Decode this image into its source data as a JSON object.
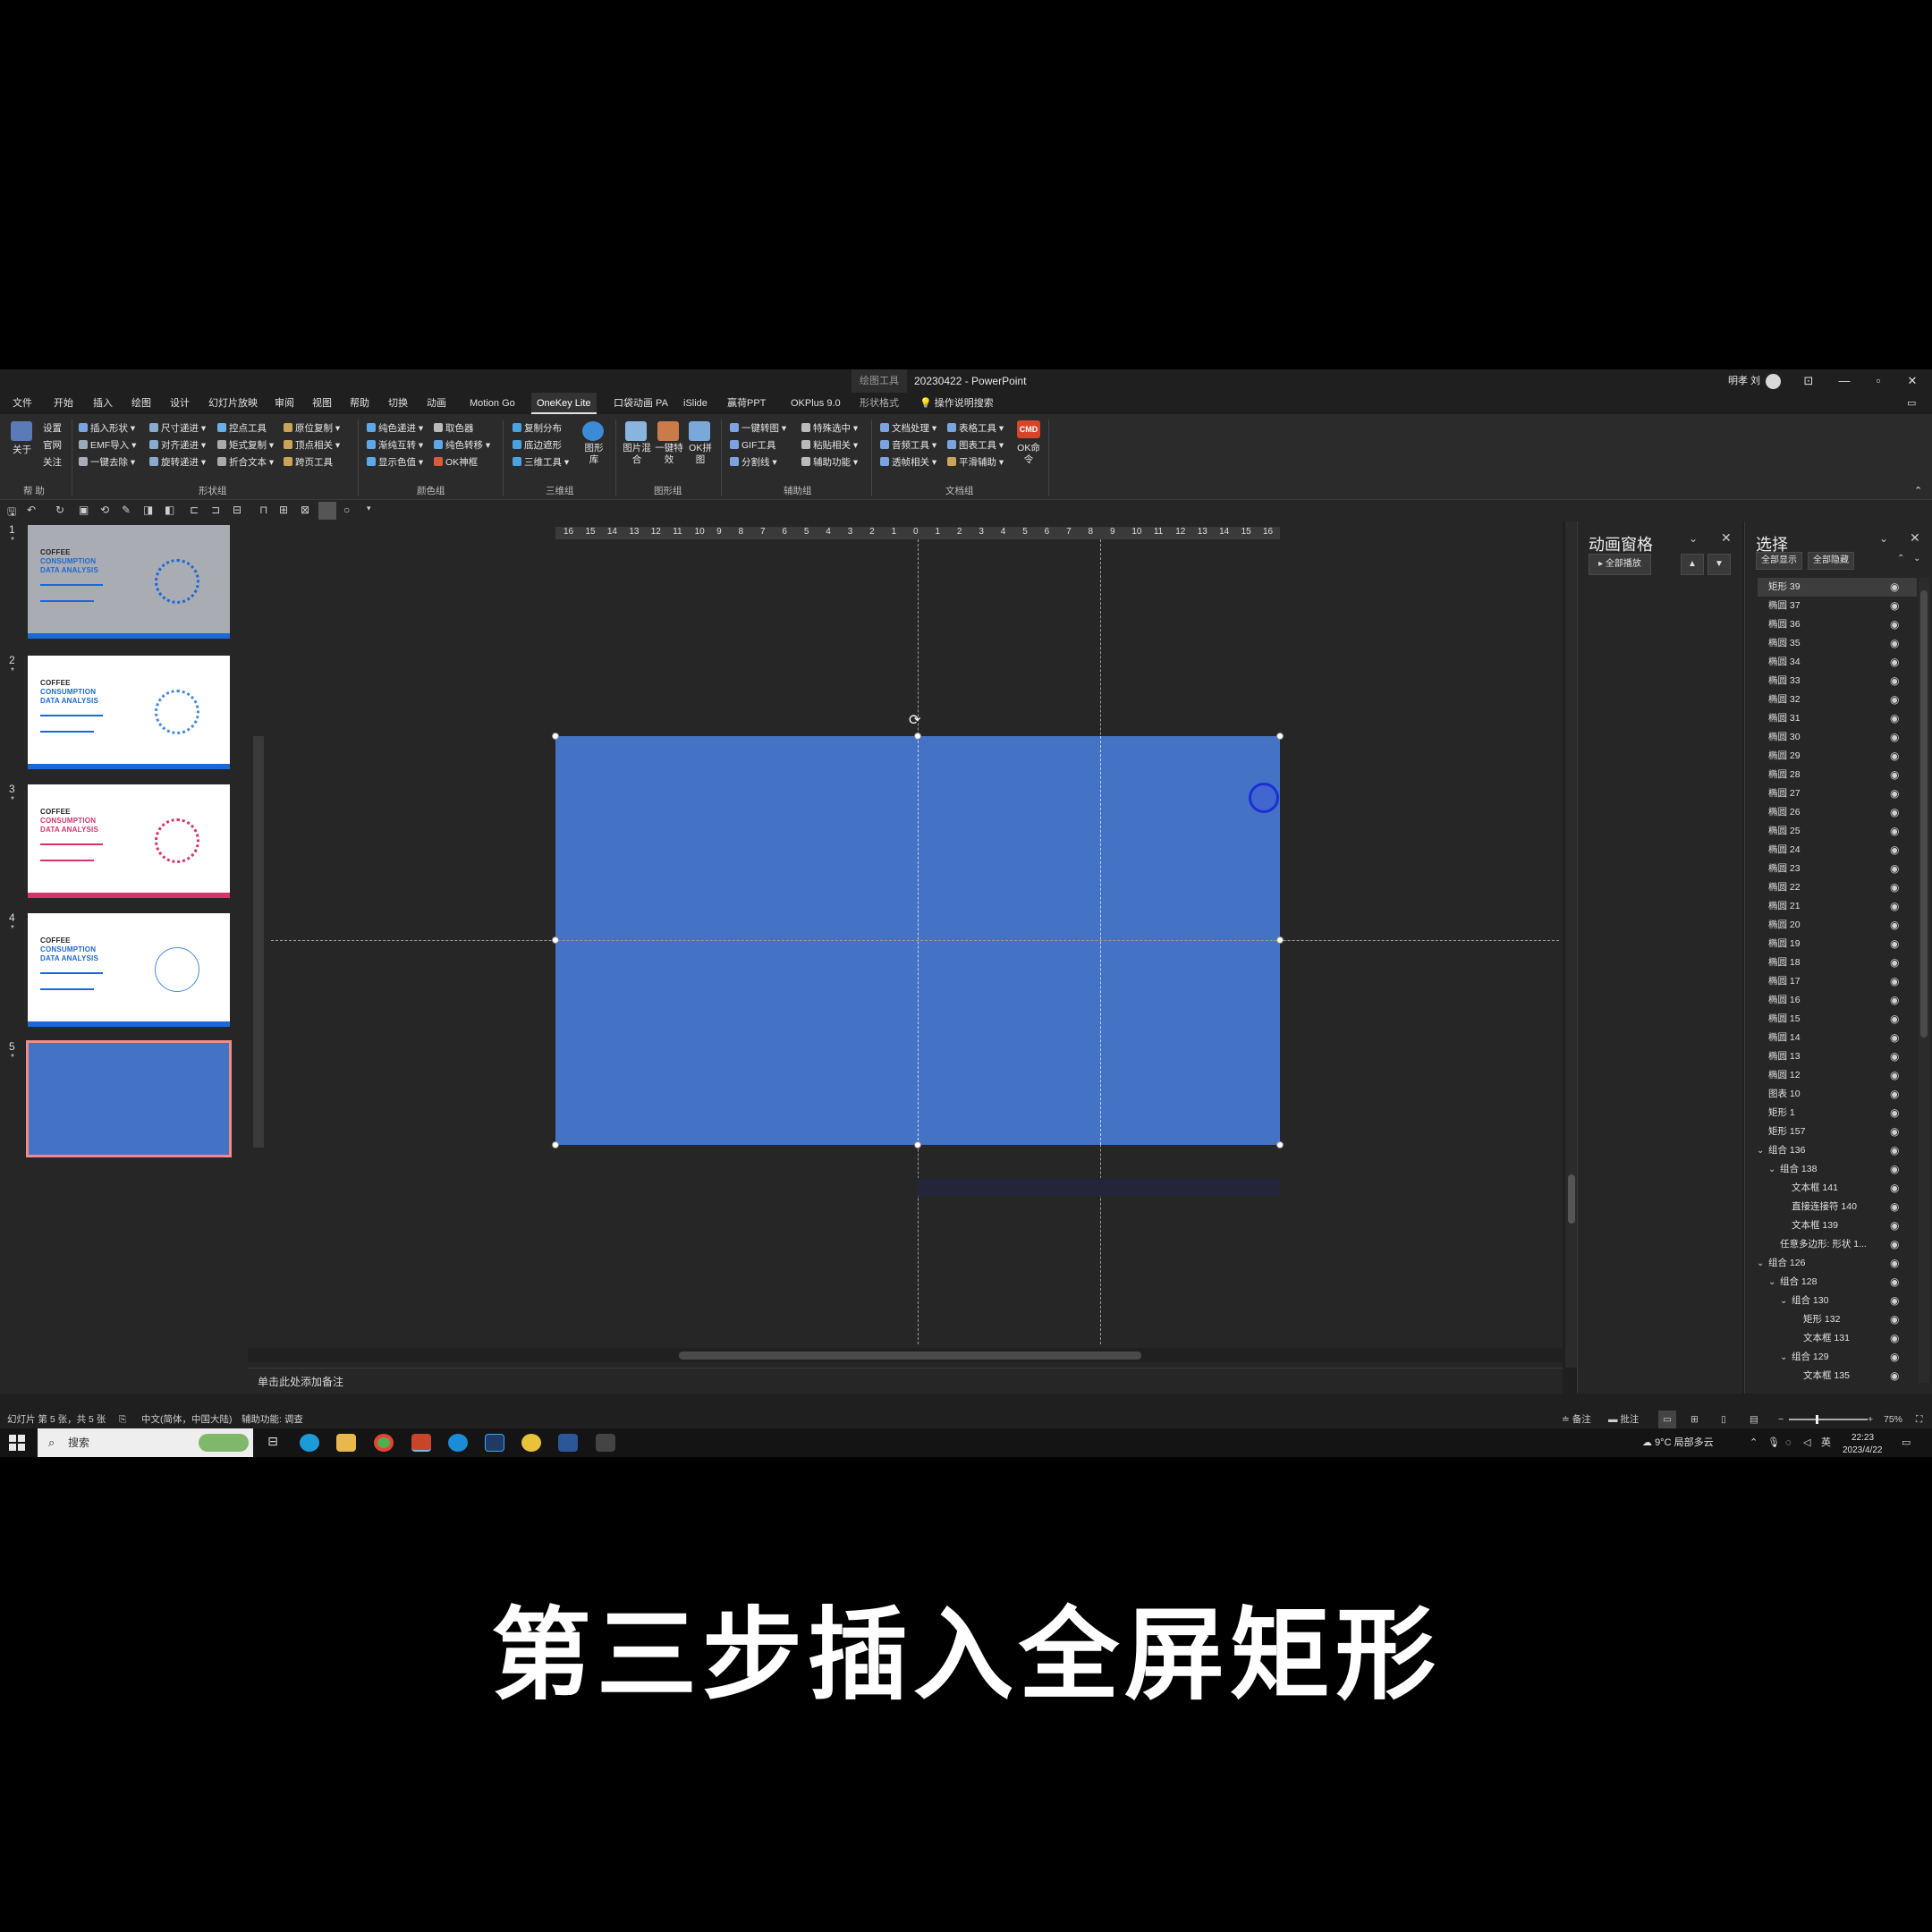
{
  "window": {
    "context_tool_label": "绘图工具",
    "doc_title": "20230422  -  PowerPoint",
    "user_name": "明孝 刘",
    "controls": [
      "⊡",
      "—",
      "▫",
      "✕"
    ]
  },
  "menu": {
    "tabs": [
      "文件",
      "开始",
      "插入",
      "绘图",
      "设计",
      "幻灯片放映",
      "审阅",
      "视图",
      "帮助",
      "切换",
      "动画",
      "Motion Go",
      "OneKey Lite",
      "口袋动画 PA",
      "iSlide",
      "赢荷PPT",
      "OKPlus 9.0",
      "形状格式"
    ],
    "active_tab": "OneKey Lite",
    "search_label": "操作说明搜索"
  },
  "ribbon": {
    "help_group": {
      "about": "关于",
      "settings": "设置",
      "site": "官网",
      "follow": "关注",
      "label": "帮 助"
    },
    "shape_group": {
      "items": [
        "插入形状",
        "EMF导入",
        "一键去除",
        "尺寸递进",
        "对齐递进",
        "旋转递进",
        "控点工具",
        "矩式复制",
        "折合文本",
        "原位复制",
        "顶点相关",
        "跨页工具"
      ],
      "label": "形状组"
    },
    "color_group": {
      "items": [
        "纯色递进",
        "渐纯互转",
        "显示色值",
        "取色器",
        "纯色转移",
        "OK神框"
      ],
      "label": "颜色组"
    },
    "3d_group": {
      "items": [
        "复制分布",
        "底边遮形",
        "三维工具"
      ],
      "big": "图形库",
      "label": "三维组"
    },
    "image_group": {
      "items": [
        "图片混合",
        "一键特效",
        "OK拼图"
      ],
      "label": "图形组"
    },
    "aux_group": {
      "items": [
        "一键转图",
        "GIF工具",
        "分割线",
        "特殊选中",
        "粘贴相关",
        "辅助功能"
      ],
      "label": "辅助组"
    },
    "doc_group": {
      "items": [
        "文档处理",
        "音频工具",
        "透帧相关",
        "表格工具",
        "图表工具",
        "平滑辅助"
      ],
      "cmd": "OK命令",
      "cmd_badge": "CMD",
      "label": "文档组"
    }
  },
  "slides": [
    {
      "num": "1",
      "title": "COFFEE",
      "line2": "CONSUMPTION",
      "line3": "DATA ANALYSIS"
    },
    {
      "num": "2",
      "title": "COFFEE",
      "line2": "CONSUMPTION",
      "line3": "DATA ANALYSIS"
    },
    {
      "num": "3",
      "title": "COFFEE",
      "line2": "CONSUMPTION",
      "line3": "DATA ANALYSIS"
    },
    {
      "num": "4",
      "title": "COFFEE",
      "line2": "CONSUMPTION",
      "line3": "DATA ANALYSIS"
    },
    {
      "num": "5"
    }
  ],
  "slide_colors": {
    "rect": "#4472c4",
    "accent_blue": "#1b68d6",
    "accent_pink": "#d6336c",
    "selection_border": "#f08c84"
  },
  "ruler": {
    "marks": [
      "16",
      "15",
      "14",
      "13",
      "12",
      "11",
      "10",
      "9",
      "8",
      "7",
      "6",
      "5",
      "4",
      "3",
      "2",
      "1",
      "0",
      "1",
      "2",
      "3",
      "4",
      "5",
      "6",
      "7",
      "8",
      "9",
      "10",
      "11",
      "12",
      "13",
      "14",
      "15",
      "16"
    ]
  },
  "notes_placeholder": "单击此处添加备注",
  "animation_pane": {
    "title": "动画窗格",
    "play_all": "全部播放"
  },
  "selection_pane": {
    "title": "选择",
    "show_all": "全部显示",
    "hide_all": "全部隐藏",
    "items": [
      {
        "label": "矩形 39",
        "level": 0
      },
      {
        "label": "椭圆 37",
        "level": 0
      },
      {
        "label": "椭圆 36",
        "level": 0
      },
      {
        "label": "椭圆 35",
        "level": 0
      },
      {
        "label": "椭圆 34",
        "level": 0
      },
      {
        "label": "椭圆 33",
        "level": 0
      },
      {
        "label": "椭圆 32",
        "level": 0
      },
      {
        "label": "椭圆 31",
        "level": 0
      },
      {
        "label": "椭圆 30",
        "level": 0
      },
      {
        "label": "椭圆 29",
        "level": 0
      },
      {
        "label": "椭圆 28",
        "level": 0
      },
      {
        "label": "椭圆 27",
        "level": 0
      },
      {
        "label": "椭圆 26",
        "level": 0
      },
      {
        "label": "椭圆 25",
        "level": 0
      },
      {
        "label": "椭圆 24",
        "level": 0
      },
      {
        "label": "椭圆 23",
        "level": 0
      },
      {
        "label": "椭圆 22",
        "level": 0
      },
      {
        "label": "椭圆 21",
        "level": 0
      },
      {
        "label": "椭圆 20",
        "level": 0
      },
      {
        "label": "椭圆 19",
        "level": 0
      },
      {
        "label": "椭圆 18",
        "level": 0
      },
      {
        "label": "椭圆 17",
        "level": 0
      },
      {
        "label": "椭圆 16",
        "level": 0
      },
      {
        "label": "椭圆 15",
        "level": 0
      },
      {
        "label": "椭圆 14",
        "level": 0
      },
      {
        "label": "椭圆 13",
        "level": 0
      },
      {
        "label": "椭圆 12",
        "level": 0
      },
      {
        "label": "图表 10",
        "level": 0
      },
      {
        "label": "矩形 1",
        "level": 0
      },
      {
        "label": "矩形 157",
        "level": 0
      },
      {
        "label": "组合 136",
        "level": 0,
        "group": true
      },
      {
        "label": "组合 138",
        "level": 1,
        "group": true
      },
      {
        "label": "文本框 141",
        "level": 2
      },
      {
        "label": "直接连接符 140",
        "level": 2
      },
      {
        "label": "文本框 139",
        "level": 2
      },
      {
        "label": "任意多边形: 形状 1...",
        "level": 1
      },
      {
        "label": "组合 126",
        "level": 0,
        "group": true
      },
      {
        "label": "组合 128",
        "level": 1,
        "group": true
      },
      {
        "label": "组合 130",
        "level": 2,
        "group": true
      },
      {
        "label": "矩形 132",
        "level": 3
      },
      {
        "label": "文本框 131",
        "level": 3
      },
      {
        "label": "组合 129",
        "level": 2,
        "group": true
      },
      {
        "label": "文本框 135",
        "level": 3
      }
    ]
  },
  "status": {
    "slide_info": "幻灯片 第 5 张，共 5 张",
    "language": "中文(简体，中国大陆)",
    "accessibility": "辅助功能: 调查",
    "notes": "备注",
    "comments": "批注",
    "zoom": "75%"
  },
  "taskbar": {
    "search": "搜索",
    "weather": "9°C  局部多云",
    "ime": "英",
    "time": "22:23",
    "date": "2023/4/22"
  },
  "caption": "第三步插入全屏矩形"
}
